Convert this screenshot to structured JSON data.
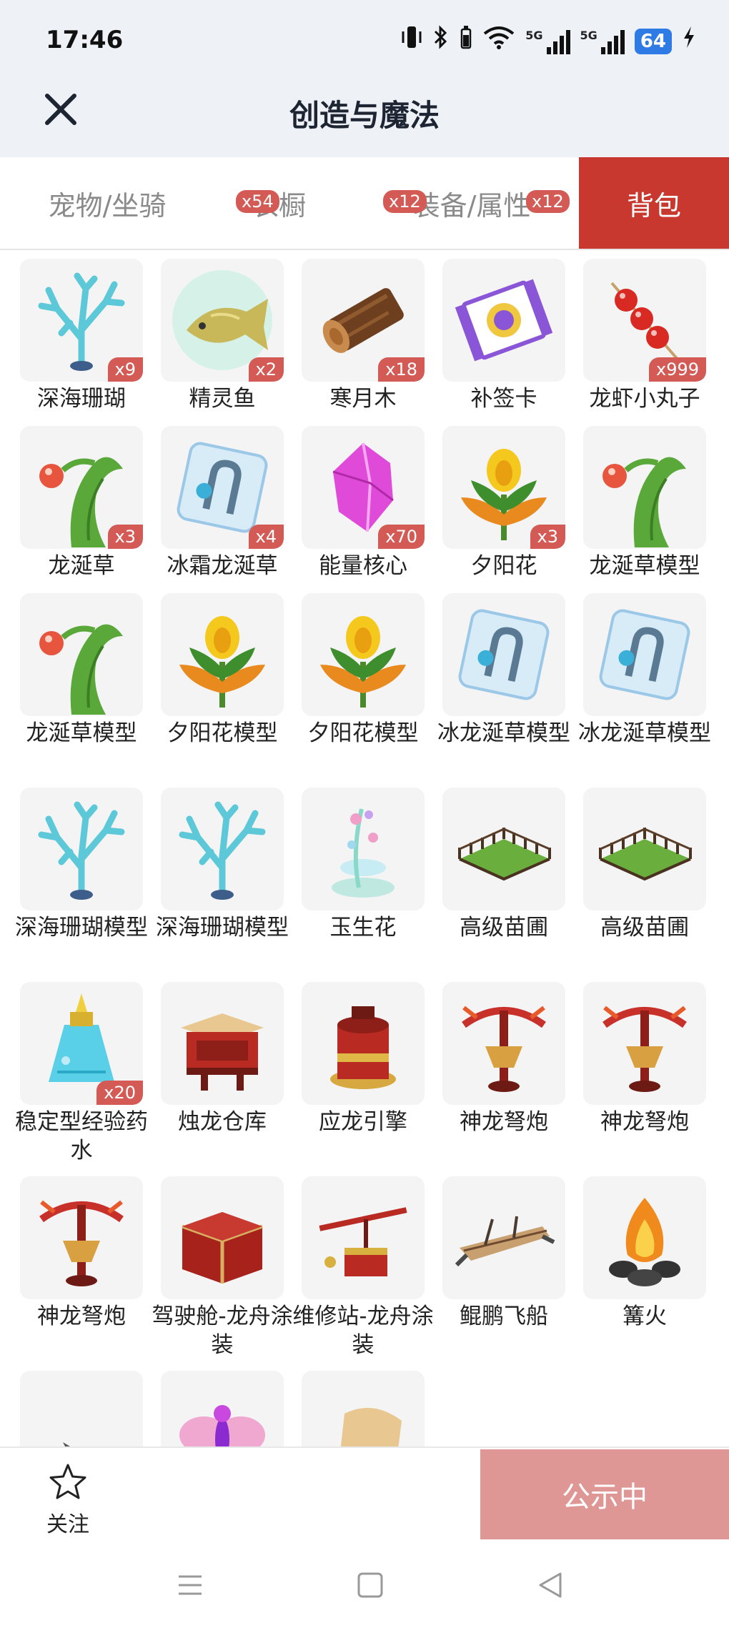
{
  "status_bar": {
    "time": "17:46",
    "network_tag": "5G",
    "battery": "64"
  },
  "header": {
    "title": "创造与魔法",
    "close_icon": "close-icon"
  },
  "tabs": [
    {
      "label": "宠物/坐骑",
      "badge": ""
    },
    {
      "label": "衣橱",
      "badge": "x54"
    },
    {
      "label": "装备/属性",
      "badge": "x12"
    },
    {
      "label": "",
      "badge": "x12"
    },
    {
      "label": "背包",
      "badge": ""
    }
  ],
  "items": [
    {
      "name": "深海珊瑚",
      "count": "x9",
      "icon": "coral-icon"
    },
    {
      "name": "精灵鱼",
      "count": "x2",
      "icon": "fish-icon"
    },
    {
      "name": "寒月木",
      "count": "x18",
      "icon": "log-icon"
    },
    {
      "name": "补签卡",
      "count": "",
      "icon": "card-icon"
    },
    {
      "name": "龙虾小丸子",
      "count": "x999",
      "icon": "skewer-icon"
    },
    {
      "name": "龙涎草",
      "count": "x3",
      "icon": "dragon-grass-icon"
    },
    {
      "name": "冰霜龙涎草",
      "count": "x4",
      "icon": "ice-block-icon"
    },
    {
      "name": "能量核心",
      "count": "x70",
      "icon": "crystal-icon"
    },
    {
      "name": "夕阳花",
      "count": "x3",
      "icon": "sunset-flower-icon"
    },
    {
      "name": "龙涎草模型",
      "count": "",
      "icon": "dragon-grass-icon"
    },
    {
      "name": "龙涎草模型",
      "count": "",
      "icon": "dragon-grass-icon"
    },
    {
      "name": "夕阳花模型",
      "count": "",
      "icon": "sunset-flower-icon"
    },
    {
      "name": "夕阳花模型",
      "count": "",
      "icon": "sunset-flower-icon"
    },
    {
      "name": "冰龙涎草模型",
      "count": "",
      "icon": "ice-block-icon"
    },
    {
      "name": "冰龙涎草模型",
      "count": "",
      "icon": "ice-block-icon"
    },
    {
      "name": "深海珊瑚模型",
      "count": "",
      "icon": "coral-icon"
    },
    {
      "name": "深海珊瑚模型",
      "count": "",
      "icon": "coral-icon"
    },
    {
      "name": "玉生花",
      "count": "",
      "icon": "jade-flower-icon"
    },
    {
      "name": "高级苗圃",
      "count": "",
      "icon": "nursery-icon"
    },
    {
      "name": "高级苗圃",
      "count": "",
      "icon": "nursery-icon"
    },
    {
      "name": "稳定型经验药水",
      "count": "x20",
      "icon": "potion-icon"
    },
    {
      "name": "烛龙仓库",
      "count": "",
      "icon": "warehouse-icon"
    },
    {
      "name": "应龙引擎",
      "count": "",
      "icon": "engine-icon"
    },
    {
      "name": "神龙弩炮",
      "count": "",
      "icon": "crossbow-icon"
    },
    {
      "name": "神龙弩炮",
      "count": "",
      "icon": "crossbow-icon"
    },
    {
      "name": "神龙弩炮",
      "count": "",
      "icon": "crossbow-icon"
    },
    {
      "name": "驾驶舱-龙舟涂装",
      "count": "",
      "icon": "cockpit-icon"
    },
    {
      "name": "维修站-龙舟涂装",
      "count": "",
      "icon": "repair-station-icon"
    },
    {
      "name": "鲲鹏飞船",
      "count": "",
      "icon": "airship-icon"
    },
    {
      "name": "篝火",
      "count": "",
      "icon": "bonfire-icon"
    },
    {
      "name": "",
      "count": "",
      "icon": "wolf-icon"
    },
    {
      "name": "",
      "count": "",
      "icon": "butterfly-icon"
    },
    {
      "name": "",
      "count": "",
      "icon": "scroll-icon"
    }
  ],
  "footer": {
    "follow_label": "关注",
    "public_label": "公示中"
  },
  "colors": {
    "accent": "#c8382f",
    "badge": "#d45b55",
    "public_button": "#de9795",
    "header_bg": "#eef2f7"
  }
}
